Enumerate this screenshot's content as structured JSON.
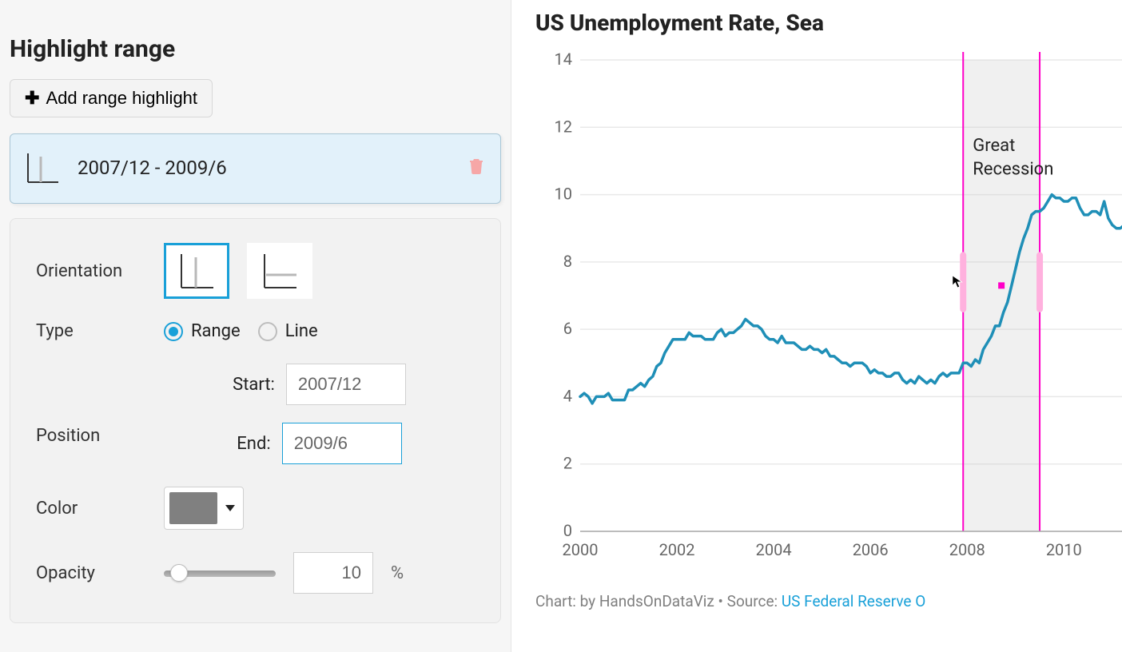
{
  "sidebar": {
    "section_title": "Highlight range",
    "add_button_label": "Add range highlight",
    "item_label": "2007/12 - 2009/6",
    "orientation_label": "Orientation",
    "type_label": "Type",
    "type_options": {
      "range": "Range",
      "line": "Line"
    },
    "position_label": "Position",
    "start_label": "Start:",
    "end_label": "End:",
    "start_value": "2007/12",
    "end_value": "2009/6",
    "color_label": "Color",
    "color_value": "#808080",
    "opacity_label": "Opacity",
    "opacity_value": "10",
    "opacity_unit": "%"
  },
  "chart_title": "US Unemployment Rate, Sea",
  "annotation": {
    "line1": "Great",
    "line2": "Recession"
  },
  "credit_prefix": "Chart: by HandsOnDataViz • Source: ",
  "credit_link": "US Federal Reserve O",
  "chart_data": {
    "type": "line",
    "title": "US Unemployment Rate, Seasonally Adjusted",
    "xlabel": "",
    "ylabel": "",
    "ylim": [
      0,
      14
    ],
    "y_ticks": [
      0,
      2,
      4,
      6,
      8,
      10,
      12,
      14
    ],
    "x_ticks": [
      2000,
      2002,
      2004,
      2006,
      2008,
      2010
    ],
    "highlight": {
      "start": 2007.917,
      "end": 2009.5,
      "color": "#808080",
      "opacity": 0.1,
      "label": "Great Recession"
    },
    "x": [
      2000.0,
      2000.083,
      2000.167,
      2000.25,
      2000.333,
      2000.417,
      2000.5,
      2000.583,
      2000.667,
      2000.75,
      2000.833,
      2000.917,
      2001.0,
      2001.083,
      2001.167,
      2001.25,
      2001.333,
      2001.417,
      2001.5,
      2001.583,
      2001.667,
      2001.75,
      2001.833,
      2001.917,
      2002.0,
      2002.083,
      2002.167,
      2002.25,
      2002.333,
      2002.417,
      2002.5,
      2002.583,
      2002.667,
      2002.75,
      2002.833,
      2002.917,
      2003.0,
      2003.083,
      2003.167,
      2003.25,
      2003.333,
      2003.417,
      2003.5,
      2003.583,
      2003.667,
      2003.75,
      2003.833,
      2003.917,
      2004.0,
      2004.083,
      2004.167,
      2004.25,
      2004.333,
      2004.417,
      2004.5,
      2004.583,
      2004.667,
      2004.75,
      2004.833,
      2004.917,
      2005.0,
      2005.083,
      2005.167,
      2005.25,
      2005.333,
      2005.417,
      2005.5,
      2005.583,
      2005.667,
      2005.75,
      2005.833,
      2005.917,
      2006.0,
      2006.083,
      2006.167,
      2006.25,
      2006.333,
      2006.417,
      2006.5,
      2006.583,
      2006.667,
      2006.75,
      2006.833,
      2006.917,
      2007.0,
      2007.083,
      2007.167,
      2007.25,
      2007.333,
      2007.417,
      2007.5,
      2007.583,
      2007.667,
      2007.75,
      2007.833,
      2007.917,
      2008.0,
      2008.083,
      2008.167,
      2008.25,
      2008.333,
      2008.417,
      2008.5,
      2008.583,
      2008.667,
      2008.75,
      2008.833,
      2008.917,
      2009.0,
      2009.083,
      2009.167,
      2009.25,
      2009.333,
      2009.417,
      2009.5,
      2009.583,
      2009.667,
      2009.75,
      2009.833,
      2009.917,
      2010.0,
      2010.083,
      2010.167,
      2010.25,
      2010.333,
      2010.417,
      2010.5,
      2010.583,
      2010.667,
      2010.75,
      2010.833,
      2010.917,
      2011.0,
      2011.083,
      2011.167,
      2011.25
    ],
    "values": [
      4.0,
      4.1,
      4.0,
      3.8,
      4.0,
      4.0,
      4.0,
      4.1,
      3.9,
      3.9,
      3.9,
      3.9,
      4.2,
      4.2,
      4.3,
      4.4,
      4.3,
      4.5,
      4.6,
      4.9,
      5.0,
      5.3,
      5.5,
      5.7,
      5.7,
      5.7,
      5.7,
      5.9,
      5.8,
      5.8,
      5.8,
      5.7,
      5.7,
      5.7,
      5.9,
      6.0,
      5.8,
      5.9,
      5.9,
      6.0,
      6.1,
      6.3,
      6.2,
      6.1,
      6.1,
      6.0,
      5.8,
      5.7,
      5.7,
      5.6,
      5.8,
      5.6,
      5.6,
      5.6,
      5.5,
      5.4,
      5.4,
      5.5,
      5.4,
      5.4,
      5.3,
      5.4,
      5.2,
      5.2,
      5.1,
      5.0,
      5.0,
      4.9,
      5.0,
      5.0,
      5.0,
      4.9,
      4.7,
      4.8,
      4.7,
      4.7,
      4.6,
      4.6,
      4.7,
      4.7,
      4.5,
      4.4,
      4.5,
      4.4,
      4.6,
      4.5,
      4.4,
      4.5,
      4.4,
      4.6,
      4.7,
      4.6,
      4.7,
      4.7,
      4.7,
      5.0,
      5.0,
      4.9,
      5.1,
      5.0,
      5.4,
      5.6,
      5.8,
      6.1,
      6.1,
      6.5,
      6.8,
      7.3,
      7.8,
      8.3,
      8.7,
      9.0,
      9.4,
      9.5,
      9.5,
      9.6,
      9.8,
      10.0,
      9.9,
      9.9,
      9.8,
      9.8,
      9.9,
      9.9,
      9.6,
      9.4,
      9.4,
      9.5,
      9.5,
      9.4,
      9.8,
      9.3,
      9.1,
      9.0,
      9.0,
      9.1
    ]
  }
}
